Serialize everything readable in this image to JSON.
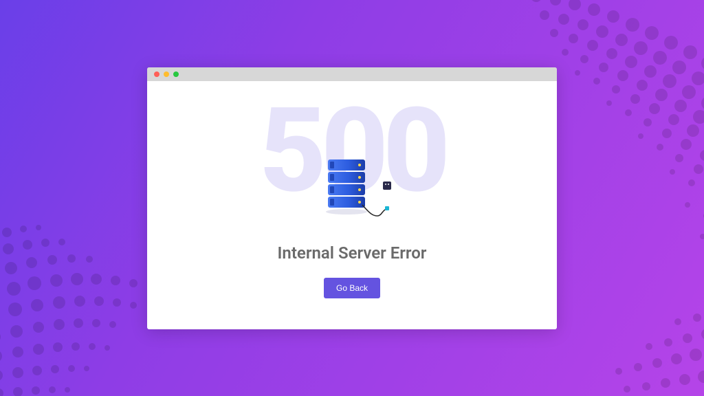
{
  "error": {
    "code": "500",
    "title": "Internal Server Error",
    "button_label": "Go Back"
  }
}
